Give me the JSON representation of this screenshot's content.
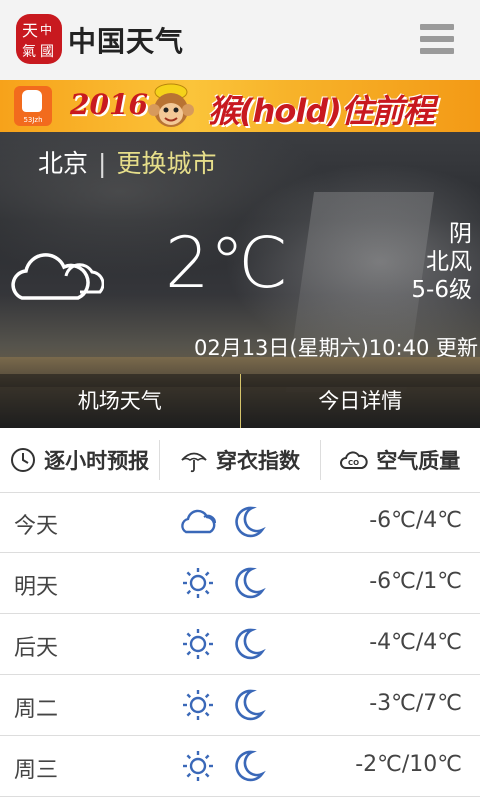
{
  "header": {
    "logo_text": "中国天气",
    "menu_icon": "hamburger-menu-icon"
  },
  "banner": {
    "year": "2016",
    "slogan": "猴(hold)住前程",
    "app_badge": "53Jzh"
  },
  "current": {
    "city": "北京",
    "separator": "|",
    "change_city": "更换城市",
    "temperature": "2℃",
    "condition": "阴",
    "wind_dir": "北风",
    "wind_level": "5-6级",
    "update_time": "02月13日(星期六)10:40 更新",
    "icon": "cloudy-icon"
  },
  "hero_tabs": [
    {
      "label": "机场天气"
    },
    {
      "label": "今日详情"
    }
  ],
  "subtabs": [
    {
      "label": "逐小时预报",
      "icon": "clock-icon"
    },
    {
      "label": "穿衣指数",
      "icon": "umbrella-icon"
    },
    {
      "label": "空气质量",
      "icon": "air-quality-icon"
    }
  ],
  "forecast": [
    {
      "day": "今天",
      "day_icon": "cloudy-icon",
      "night_icon": "moon-icon",
      "range": "-6℃/4℃"
    },
    {
      "day": "明天",
      "day_icon": "sun-icon",
      "night_icon": "moon-icon",
      "range": "-6℃/1℃"
    },
    {
      "day": "后天",
      "day_icon": "sun-icon",
      "night_icon": "moon-icon",
      "range": "-4℃/4℃"
    },
    {
      "day": "周二",
      "day_icon": "sun-icon",
      "night_icon": "moon-icon",
      "range": "-3℃/7℃"
    },
    {
      "day": "周三",
      "day_icon": "sun-icon",
      "night_icon": "moon-icon",
      "range": "-2℃/10℃"
    }
  ],
  "colors": {
    "accent_blue": "#3a68b8",
    "change_city": "#e6de8a",
    "brand_red": "#c8191f"
  }
}
